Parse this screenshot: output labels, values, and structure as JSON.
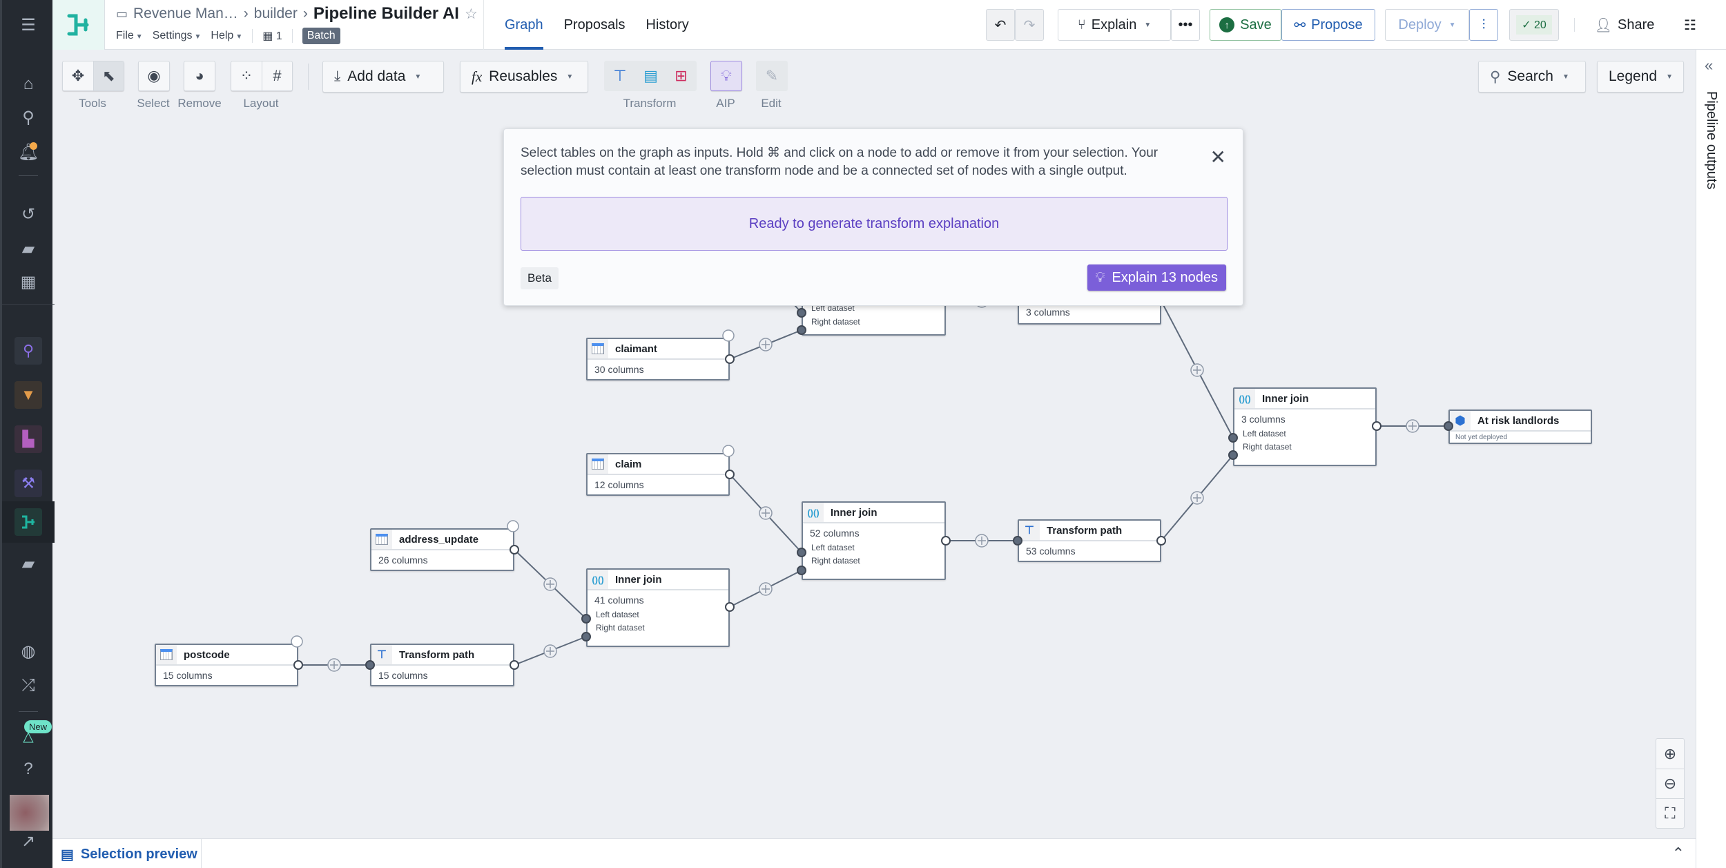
{
  "header": {
    "breadcrumb": [
      "Revenue Man…",
      "builder"
    ],
    "title": "Pipeline Builder AI",
    "menus": [
      "File",
      "Settings",
      "Help"
    ],
    "branch_count": "1",
    "mode_tag": "Batch",
    "tabs": [
      {
        "label": "Graph",
        "active": true
      },
      {
        "label": "Proposals",
        "active": false
      },
      {
        "label": "History",
        "active": false
      }
    ],
    "explain_label": "Explain",
    "save_label": "Save",
    "propose_label": "Propose",
    "deploy_label": "Deploy",
    "checks_count": "20",
    "share_label": "Share"
  },
  "toolbar": {
    "tools_label": "Tools",
    "select_label": "Select",
    "remove_label": "Remove",
    "layout_label": "Layout",
    "add_data_label": "Add data",
    "reusables_label": "Reusables",
    "transform_label": "Transform",
    "aip_label": "AIP",
    "edit_label": "Edit",
    "search_label": "Search",
    "legend_label": "Legend"
  },
  "right_panel": {
    "title": "Pipeline outputs"
  },
  "dialog": {
    "instructions": "Select tables on the graph as inputs. Hold ⌘ and click on a node to add or remove it from your selection. Your selection must contain at least one transform node and be a connected set of nodes with a single output.",
    "status": "Ready to generate transform explanation",
    "beta_tag": "Beta",
    "explain_button": "Explain 13 nodes"
  },
  "graph": {
    "nodes": [
      {
        "id": "claimant",
        "type": "dataset",
        "title": "claimant",
        "cols": "30 columns"
      },
      {
        "id": "claim",
        "type": "dataset",
        "title": "claim",
        "cols": "12 columns"
      },
      {
        "id": "address_update",
        "type": "dataset",
        "title": "address_update",
        "cols": "26 columns"
      },
      {
        "id": "postcode",
        "type": "dataset",
        "title": "postcode",
        "cols": "15 columns"
      },
      {
        "id": "tp1",
        "type": "transform",
        "title": "Transform path",
        "cols": "15 columns"
      },
      {
        "id": "ij1",
        "type": "join",
        "title": "Inner join",
        "cols": "41 columns",
        "left": "Left dataset",
        "right": "Right dataset"
      },
      {
        "id": "ij2",
        "type": "join",
        "title": "Inner join",
        "cols": "52 columns",
        "left": "Left dataset",
        "right": "Right dataset"
      },
      {
        "id": "tp2",
        "type": "transform",
        "title": "Transform path",
        "cols": "53 columns"
      },
      {
        "id": "ij_top",
        "type": "join",
        "title": "",
        "cols": "",
        "left": "Left dataset",
        "right": "Right dataset"
      },
      {
        "id": "top_right",
        "type": "transform",
        "title": "",
        "cols": "3 columns"
      },
      {
        "id": "ij3",
        "type": "join",
        "title": "Inner join",
        "cols": "3 columns",
        "left": "Left dataset",
        "right": "Right dataset"
      },
      {
        "id": "output",
        "type": "output",
        "title": "At risk landlords",
        "status": "Not yet deployed"
      }
    ]
  },
  "bottom": {
    "selection_preview": "Selection preview"
  },
  "sidebar": {
    "new_badge": "New"
  }
}
